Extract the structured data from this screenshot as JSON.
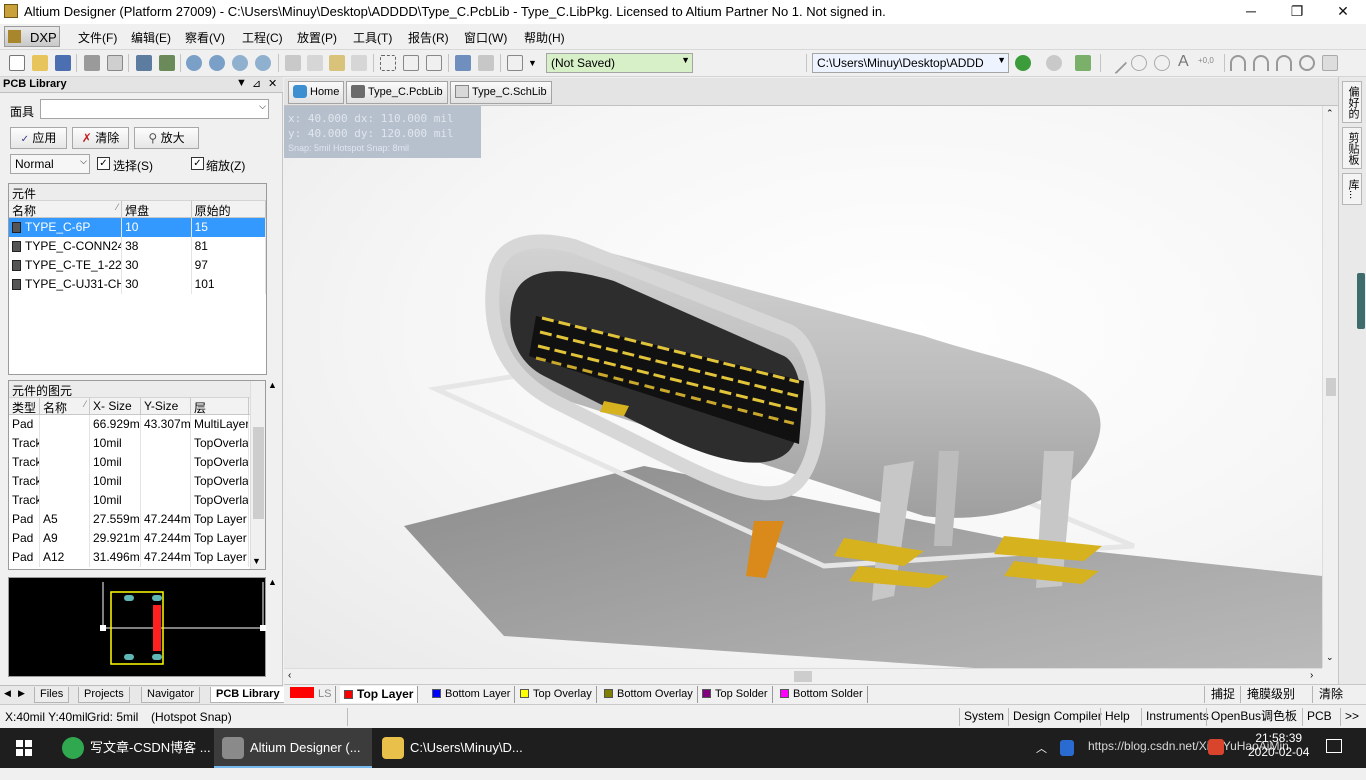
{
  "window": {
    "title": "Altium Designer (Platform 27009) - C:\\Users\\Minuy\\Desktop\\ADDDD\\Type_C.PcbLib - Type_C.LibPkg. Licensed to Altium Partner No 1. Not signed in.",
    "minimize": "─",
    "maximize": "❐",
    "close": "✕"
  },
  "menu": {
    "dxp": "DXP",
    "items": [
      "文件(F)",
      "编辑(E)",
      "察看(V)",
      "工程(C)",
      "放置(P)",
      "工具(T)",
      "报告(R)",
      "窗口(W)",
      "帮助(H)"
    ]
  },
  "toolbar": {
    "saved_state": "(Not Saved)",
    "path": "C:\\Users\\Minuy\\Desktop\\ADDD"
  },
  "panel": {
    "title": "PCB Library",
    "mask_label": "面具",
    "mask_value": "",
    "apply_btn": "应用",
    "clear_btn": "清除",
    "zoom_btn": "放大",
    "mode": "Normal",
    "select_label": "选择(S)",
    "zoom_label": "缩放(Z)",
    "components": {
      "title": "元件",
      "headers": [
        "名称",
        "焊盘",
        "原始的"
      ],
      "rows": [
        {
          "name": "TYPE_C-6P",
          "pads": "10",
          "primitives": "15"
        },
        {
          "name": "TYPE_C-CONN24",
          "pads": "38",
          "primitives": "81"
        },
        {
          "name": "TYPE_C-TE_1-22",
          "pads": "30",
          "primitives": "97"
        },
        {
          "name": "TYPE_C-UJ31-CH",
          "pads": "30",
          "primitives": "101"
        }
      ]
    },
    "primitives": {
      "title": "元件的图元",
      "headers": [
        "类型",
        "名称",
        "X- Size",
        "Y-Size",
        "层"
      ],
      "rows": [
        {
          "type": "Pad",
          "name": "",
          "xs": "66.929mil",
          "ys": "43.307mil",
          "layer": "MultiLayer"
        },
        {
          "type": "Track",
          "name": "",
          "xs": "10mil",
          "ys": "",
          "layer": "TopOverlay"
        },
        {
          "type": "Track",
          "name": "",
          "xs": "10mil",
          "ys": "",
          "layer": "TopOverlay"
        },
        {
          "type": "Track",
          "name": "",
          "xs": "10mil",
          "ys": "",
          "layer": "TopOverlay"
        },
        {
          "type": "Track",
          "name": "",
          "xs": "10mil",
          "ys": "",
          "layer": "TopOverlay"
        },
        {
          "type": "Pad",
          "name": "A5",
          "xs": "27.559mil",
          "ys": "47.244mil",
          "layer": "Top Layer"
        },
        {
          "type": "Pad",
          "name": "A9",
          "xs": "29.921mil",
          "ys": "47.244mil",
          "layer": "Top Layer"
        },
        {
          "type": "Pad",
          "name": "A12",
          "xs": "31.496mil",
          "ys": "47.244mil",
          "layer": "Top Layer"
        }
      ]
    },
    "tabs": [
      "Files",
      "Projects",
      "Navigator",
      "PCB Library"
    ]
  },
  "doc_tabs": [
    "Home",
    "Type_C.PcbLib",
    "Type_C.SchLib"
  ],
  "hud": {
    "line1": "x:   40.000   dx:   110.000 mil",
    "line2": "y:   40.000   dy:   120.000 mil",
    "line3": "Snap: 5mil Hotspot Snap: 8mil"
  },
  "right_tabs": [
    "偏好的",
    "剪贴板",
    "库..."
  ],
  "layers": {
    "ls": "LS",
    "items": [
      {
        "label": "Top Layer",
        "color": "#ff0000"
      },
      {
        "label": "Bottom Layer",
        "color": "#0000ff"
      },
      {
        "label": "Top Overlay",
        "color": "#ffff00"
      },
      {
        "label": "Bottom Overlay",
        "color": "#808000"
      },
      {
        "label": "Top Solder",
        "color": "#800080"
      },
      {
        "label": "Bottom Solder",
        "color": "#ff00ff"
      }
    ],
    "snap": "捕捉",
    "mask_level": "掩膜级别",
    "clear": "清除"
  },
  "status": {
    "coords": "X:40mil Y:40mil",
    "grid": "Grid: 5mil",
    "snap": "(Hotspot Snap)",
    "buttons": [
      "System",
      "Design Compiler",
      "Help",
      "Instruments",
      "OpenBus调色板",
      "PCB",
      ">>"
    ]
  },
  "taskbar": {
    "apps": [
      "写文章-CSDN博客 ...",
      "Altium Designer (...",
      "C:\\Users\\Minuy\\D..."
    ],
    "watermark": "https://blog.csdn.net/XiaoYuHaoAiMin",
    "time": "21:58:39",
    "date": "2020-02-04",
    "ime": "中"
  }
}
